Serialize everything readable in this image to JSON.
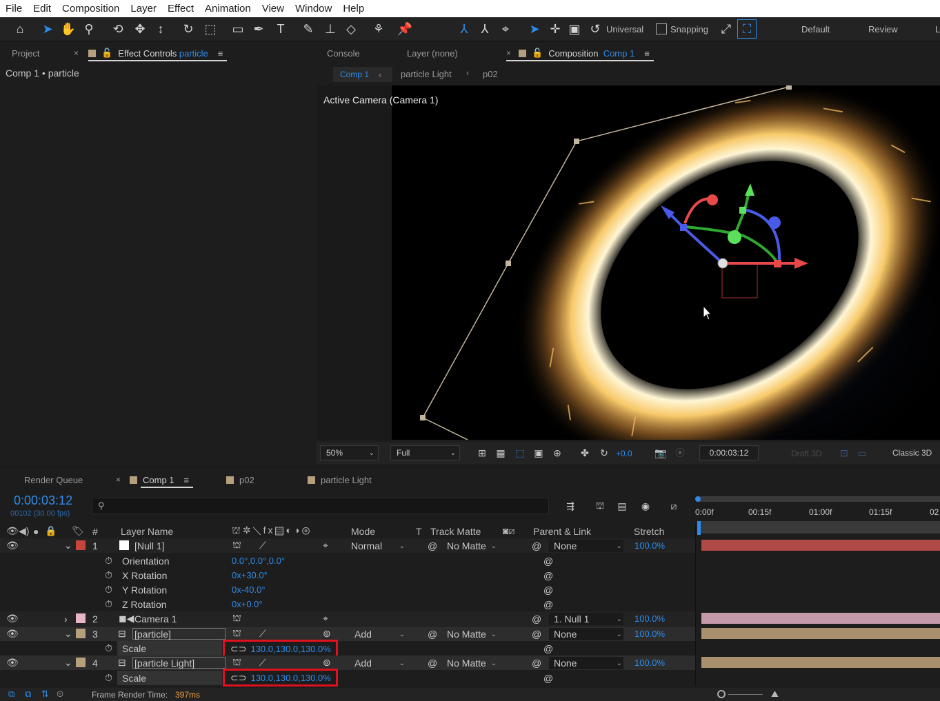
{
  "menu": [
    "File",
    "Edit",
    "Composition",
    "Layer",
    "Effect",
    "Animation",
    "View",
    "Window",
    "Help"
  ],
  "toolbar": {
    "universal_label": "Universal",
    "snapping_label": "Snapping",
    "workspaces": [
      "Default",
      "Review",
      "L"
    ]
  },
  "left_panel": {
    "tabs": [
      "Project",
      "Effect Controls"
    ],
    "effect_controls_layer": "particle",
    "breadcrumb": "Comp 1 • particle"
  },
  "right_panel": {
    "tabs": [
      "Console",
      "Layer (none)",
      "Composition"
    ],
    "composition_name": "Comp 1",
    "breadcrumbs": [
      "Comp 1",
      "particle Light",
      "p02"
    ],
    "viewer_label": "Active Camera (Camera 1)"
  },
  "viewer_bar": {
    "zoom": "50%",
    "resolution": "Full",
    "exposure": "+0.0",
    "timecode": "0:00:03:12",
    "draft3d": "Draft 3D",
    "renderer": "Classic 3D"
  },
  "timeline": {
    "tabs": [
      "Render Queue",
      "Comp 1",
      "p02",
      "particle Light"
    ],
    "current_time": "0:00:03:12",
    "frame_info": "00102 (30.00 fps)",
    "search_placeholder": "",
    "headers": {
      "num": "#",
      "layer_name": "Layer Name",
      "mode": "Mode",
      "t": "T",
      "track_matte": "Track Matte",
      "parent_link": "Parent & Link",
      "stretch": "Stretch"
    },
    "ruler": [
      "0:00f",
      "00:15f",
      "01:00f",
      "01:15f",
      "02"
    ],
    "layers": [
      {
        "num": "1",
        "name": "[Null 1]",
        "color": "#c6463e",
        "mode": "Normal",
        "matte": "No Matte",
        "parent": "None",
        "stretch": "100.0%"
      },
      {
        "num": "2",
        "name": "Camera 1",
        "color": "#e8b5c4",
        "parent": "1. Null 1",
        "stretch": "100.0%"
      },
      {
        "num": "3",
        "name": "[particle]",
        "color": "#b59f7c",
        "mode": "Add",
        "matte": "No Matte",
        "parent": "None",
        "stretch": "100.0%"
      },
      {
        "num": "4",
        "name": "[particle Light]",
        "color": "#b59f7c",
        "mode": "Add",
        "matte": "No Matte",
        "parent": "None",
        "stretch": "100.0%"
      }
    ],
    "null_props": [
      {
        "name": "Orientation",
        "value": "0.0°,0.0°,0.0°"
      },
      {
        "name": "X Rotation",
        "value": "0x+30.0°"
      },
      {
        "name": "Y Rotation",
        "value": "0x-40.0°"
      },
      {
        "name": "Z Rotation",
        "value": "0x+0.0°"
      }
    ],
    "particle_scale": {
      "name": "Scale",
      "value": "130.0,130.0,130.0%"
    },
    "light_scale": {
      "name": "Scale",
      "value": "130.0,130.0,130.0%"
    },
    "footer": {
      "label": "Frame Render Time:",
      "value": "397ms"
    }
  },
  "colors": {
    "accent": "#2d8ceb",
    "highlight": "#e0101e",
    "null_bar": "#b04a47",
    "camera_bar": "#c49aab",
    "footage_bar": "#a8906c"
  }
}
